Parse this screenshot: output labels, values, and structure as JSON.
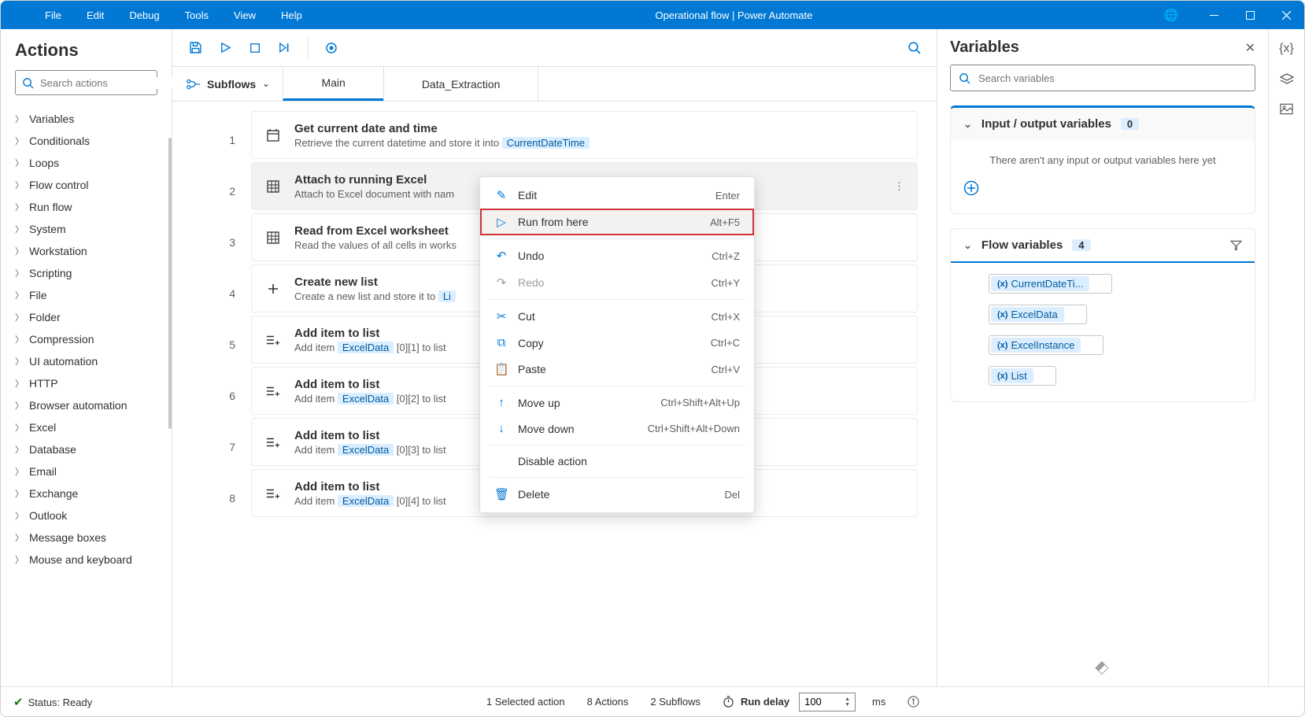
{
  "titlebar": {
    "menus": [
      "File",
      "Edit",
      "Debug",
      "Tools",
      "View",
      "Help"
    ],
    "title": "Operational flow | Power Automate"
  },
  "actions": {
    "heading": "Actions",
    "search_placeholder": "Search actions",
    "categories": [
      "Variables",
      "Conditionals",
      "Loops",
      "Flow control",
      "Run flow",
      "System",
      "Workstation",
      "Scripting",
      "File",
      "Folder",
      "Compression",
      "UI automation",
      "HTTP",
      "Browser automation",
      "Excel",
      "Database",
      "Email",
      "Exchange",
      "Outlook",
      "Message boxes",
      "Mouse and keyboard"
    ]
  },
  "editor": {
    "subflows_label": "Subflows",
    "tabs": [
      {
        "label": "Main",
        "active": true
      },
      {
        "label": "Data_Extraction",
        "active": false
      }
    ],
    "steps": [
      {
        "n": "1",
        "icon": "calendar",
        "title": "Get current date and time",
        "desc_pre": "Retrieve the current datetime and store it into ",
        "pill": "CurrentDateTime"
      },
      {
        "n": "2",
        "icon": "excel",
        "title": "Attach to running Excel",
        "desc_pre": "Attach to Excel document with nam",
        "selected": true
      },
      {
        "n": "3",
        "icon": "excel",
        "title": "Read from Excel worksheet",
        "desc_pre": "Read the values of all cells in works"
      },
      {
        "n": "4",
        "icon": "plus",
        "title": "Create new list",
        "desc_pre": "Create a new list and store it to ",
        "pill": "Li"
      },
      {
        "n": "5",
        "icon": "listadd",
        "title": "Add item to list",
        "desc_pre": "Add item ",
        "pill": "ExcelData",
        "idx": "[0][1]",
        "desc_post": " to list"
      },
      {
        "n": "6",
        "icon": "listadd",
        "title": "Add item to list",
        "desc_pre": "Add item ",
        "pill": "ExcelData",
        "idx": "[0][2]",
        "desc_post": " to list"
      },
      {
        "n": "7",
        "icon": "listadd",
        "title": "Add item to list",
        "desc_pre": "Add item ",
        "pill": "ExcelData",
        "idx": "[0][3]",
        "desc_post": " to list"
      },
      {
        "n": "8",
        "icon": "listadd",
        "title": "Add item to list",
        "desc_pre": "Add item ",
        "pill": "ExcelData",
        "idx": "[0][4]",
        "desc_post": " to list"
      }
    ]
  },
  "context_menu": [
    {
      "icon": "✎",
      "label": "Edit",
      "shortcut": "Enter"
    },
    {
      "icon": "▷",
      "label": "Run from here",
      "shortcut": "Alt+F5",
      "highlighted": true
    },
    {
      "sep": true
    },
    {
      "icon": "↶",
      "label": "Undo",
      "shortcut": "Ctrl+Z"
    },
    {
      "icon": "↷",
      "label": "Redo",
      "shortcut": "Ctrl+Y",
      "disabled": true
    },
    {
      "sep": true
    },
    {
      "icon": "✂",
      "label": "Cut",
      "shortcut": "Ctrl+X"
    },
    {
      "icon": "⧉",
      "label": "Copy",
      "shortcut": "Ctrl+C"
    },
    {
      "icon": "📋",
      "label": "Paste",
      "shortcut": "Ctrl+V"
    },
    {
      "sep": true
    },
    {
      "icon": "↑",
      "label": "Move up",
      "shortcut": "Ctrl+Shift+Alt+Up"
    },
    {
      "icon": "↓",
      "label": "Move down",
      "shortcut": "Ctrl+Shift+Alt+Down"
    },
    {
      "sep": true
    },
    {
      "icon": "",
      "label": "Disable action",
      "shortcut": ""
    },
    {
      "sep": true
    },
    {
      "icon": "🗑",
      "label": "Delete",
      "shortcut": "Del"
    }
  ],
  "variables": {
    "heading": "Variables",
    "search_placeholder": "Search variables",
    "io": {
      "title": "Input / output variables",
      "count": "0",
      "empty": "There aren't any input or output variables here yet"
    },
    "flow": {
      "title": "Flow variables",
      "count": "4",
      "items": [
        "CurrentDateTi...",
        "ExcelData",
        "ExcelInstance",
        "List"
      ]
    }
  },
  "statusbar": {
    "status": "Status: Ready",
    "selected": "1 Selected action",
    "actions": "8 Actions",
    "subflows": "2 Subflows",
    "run_delay_label": "Run delay",
    "run_delay_value": "100",
    "ms": "ms"
  }
}
